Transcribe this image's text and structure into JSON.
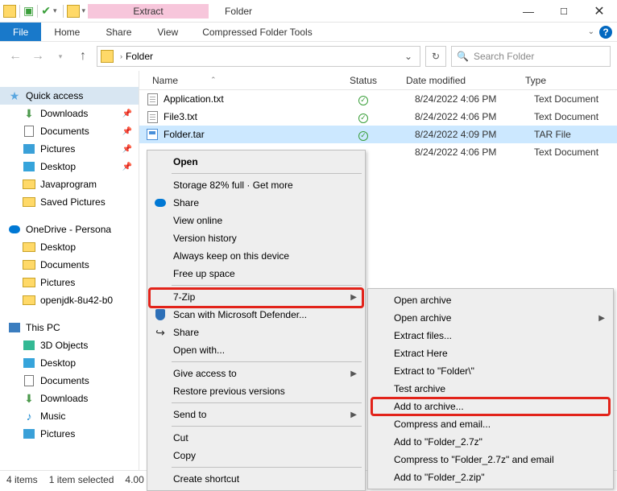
{
  "window": {
    "context_label": "Extract",
    "title": "Folder",
    "help": "?"
  },
  "ribbon": {
    "file": "File",
    "tabs": [
      "Home",
      "Share",
      "View"
    ],
    "context_tool": "Compressed Folder Tools"
  },
  "nav": {
    "path": "Folder",
    "search_placeholder": "Search Folder"
  },
  "columns": {
    "name": "Name",
    "status": "Status",
    "date": "Date modified",
    "type": "Type"
  },
  "sidebar": {
    "quick": "Quick access",
    "quick_items": [
      "Downloads",
      "Documents",
      "Pictures",
      "Desktop",
      "Javaprogram",
      "Saved Pictures"
    ],
    "onedrive": "OneDrive - Persona",
    "onedrive_items": [
      "Desktop",
      "Documents",
      "Pictures",
      "openjdk-8u42-b0"
    ],
    "thispc": "This PC",
    "pc_items": [
      "3D Objects",
      "Desktop",
      "Documents",
      "Downloads",
      "Music",
      "Pictures"
    ]
  },
  "files": [
    {
      "name": "Application.txt",
      "status": "✓",
      "date": "8/24/2022 4:06 PM",
      "type": "Text Document",
      "icon": "txt"
    },
    {
      "name": "File3.txt",
      "status": "✓",
      "date": "8/24/2022 4:06 PM",
      "type": "Text Document",
      "icon": "txt"
    },
    {
      "name": "Folder.tar",
      "status": "✓",
      "date": "8/24/2022 4:09 PM",
      "type": "TAR File",
      "icon": "tar",
      "selected": true
    },
    {
      "name": "",
      "status": "",
      "date": "8/24/2022 4:06 PM",
      "type": "Text Document",
      "icon": ""
    }
  ],
  "statusbar": {
    "count": "4 items",
    "selected": "1 item selected",
    "size": "4.00"
  },
  "context_menu": {
    "open": "Open",
    "storage": "Storage 82% full · Get more",
    "share": "Share",
    "view_online": "View online",
    "version_history": "Version history",
    "always_keep": "Always keep on this device",
    "free_up": "Free up space",
    "seven_zip": "7-Zip",
    "defender": "Scan with Microsoft Defender...",
    "share2": "Share",
    "open_with": "Open with...",
    "give_access": "Give access to",
    "restore": "Restore previous versions",
    "send_to": "Send to",
    "cut": "Cut",
    "copy": "Copy",
    "create_shortcut": "Create shortcut"
  },
  "submenu": {
    "open_archive1": "Open archive",
    "open_archive2": "Open archive",
    "extract_files": "Extract files...",
    "extract_here": "Extract Here",
    "extract_to": "Extract to \"Folder\\\"",
    "test_archive": "Test archive",
    "add_to_archive": "Add to archive...",
    "compress_email": "Compress and email...",
    "add_7z": "Add to \"Folder_2.7z\"",
    "compress_7z_email": "Compress to \"Folder_2.7z\" and email",
    "add_zip": "Add to \"Folder_2.zip\""
  }
}
